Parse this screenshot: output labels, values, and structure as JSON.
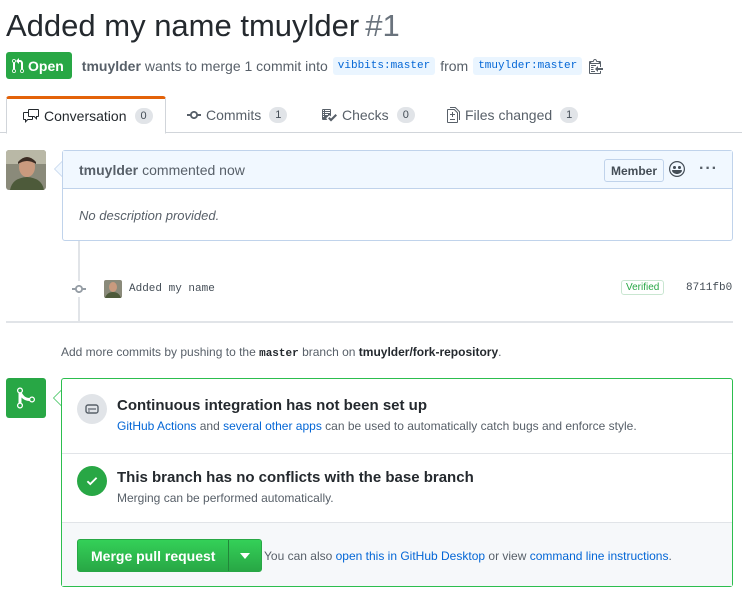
{
  "pr": {
    "title": "Added my name tmuylder",
    "number": "#1",
    "state": "Open",
    "author": "tmuylder",
    "merge_text": "wants to merge 1 commit into",
    "base_branch": "vibbits:master",
    "from_text": "from",
    "head_branch": "tmuylder:master"
  },
  "tabs": [
    {
      "label": "Conversation",
      "count": "0",
      "icon": "comment-discussion-icon"
    },
    {
      "label": "Commits",
      "count": "1",
      "icon": "git-commit-icon"
    },
    {
      "label": "Checks",
      "count": "0",
      "icon": "checklist-icon"
    },
    {
      "label": "Files changed",
      "count": "1",
      "icon": "file-diff-icon"
    }
  ],
  "comment": {
    "author": "tmuylder",
    "action": "commented now",
    "badge": "Member",
    "body": "No description provided."
  },
  "commit": {
    "message": "Added my name",
    "verified": "Verified",
    "sha": "8711fb0"
  },
  "hint": {
    "prefix": "Add more commits by pushing to the",
    "branch": "master",
    "middle": "branch on",
    "repo": "tmuylder/fork-repository",
    "suffix": "."
  },
  "merge": {
    "ci_title": "Continuous integration has not been set up",
    "ci_link1": "GitHub Actions",
    "ci_and": "and",
    "ci_link2": "several other apps",
    "ci_rest": "can be used to automatically catch bugs and enforce style.",
    "ok_title": "This branch has no conflicts with the base branch",
    "ok_desc": "Merging can be performed automatically.",
    "button": "Merge pull request",
    "also_prefix": "You can also",
    "also_link1": "open this in GitHub Desktop",
    "also_or": "or view",
    "also_link2": "command line instructions",
    "also_suffix": "."
  },
  "colors": {
    "open_green": "#28a745",
    "link_blue": "#0366d6",
    "tab_accent": "#e36209"
  }
}
